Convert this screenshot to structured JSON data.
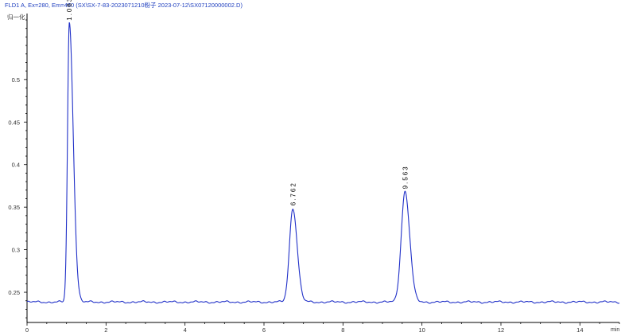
{
  "chart_data": {
    "type": "line",
    "title": "FLD1 A, Ex=280, Em=450 (SX\\SX-7-83-2023071210粉子 2023-07-12\\SX07120000002.D)",
    "ylabel": "归一化",
    "xlabel": "min",
    "xlim": [
      0,
      15
    ],
    "ylim": [
      0.2145,
      0.5775
    ],
    "grid": false,
    "line_color": "#2030c8",
    "x_ticks": [
      0,
      2,
      4,
      6,
      8,
      10,
      12,
      14
    ],
    "y_ticks": [
      0.25,
      0.3,
      0.35,
      0.4,
      0.45,
      0.5
    ],
    "baseline": 0.2385,
    "peaks": [
      {
        "label": "1.063",
        "rt": 1.07,
        "height": 0.5665,
        "sigma_left": 0.045,
        "sigma_right": 0.1
      },
      {
        "label": "6.762",
        "rt": 6.73,
        "height": 0.349,
        "sigma_left": 0.085,
        "sigma_right": 0.11
      },
      {
        "label": "9.563",
        "rt": 9.57,
        "height": 0.3685,
        "sigma_left": 0.095,
        "sigma_right": 0.12
      }
    ]
  }
}
